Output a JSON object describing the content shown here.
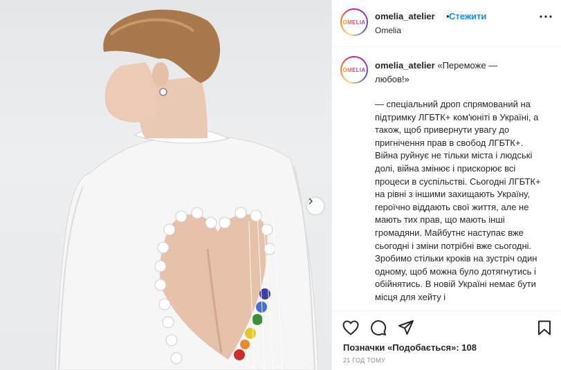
{
  "header": {
    "username": "omelia_atelier",
    "separator": "•",
    "follow_label": "Стежити",
    "subtitle": "Omelia",
    "avatar_logo_text": "OMELIA"
  },
  "caption": {
    "username": "omelia_atelier",
    "title": "«Переможе — любов!»",
    "body": "— спеціальний дроп спрямований на підтримку ЛГБТК+ ком'юніті в Україні, а також, щоб привернути увагу до пригнічення прав в свобод ЛГБТК+. Війна руйнує не тільки міста і людські долі, війна змінює і прискорює всі процеси в суспільстві. Сьогодні ЛГБТК+ на рівні з іншими захищають Україну, героїчно віддають свої життя, але не мають тих прав, що мають інші громадяни. Майбутнє наступає вже сьогодні і зміни потрібні вже сьогодні. Зробимо стільки кроків на зустріч один одному, щоб можна було дотягнутись і обійнятись. В новій Україні немає бути місця для хейту і"
  },
  "actions": {
    "like_icon": "heart-icon",
    "comment_icon": "comment-icon",
    "share_icon": "send-icon",
    "save_icon": "bookmark-icon"
  },
  "likes_text": "Позначки «Подобається»: 108",
  "timestamp": "21 ГОД ТОМУ",
  "colors": {
    "follow": "#0095f6",
    "text": "#262626",
    "muted": "#8e8e8e",
    "divider": "#efefef"
  }
}
